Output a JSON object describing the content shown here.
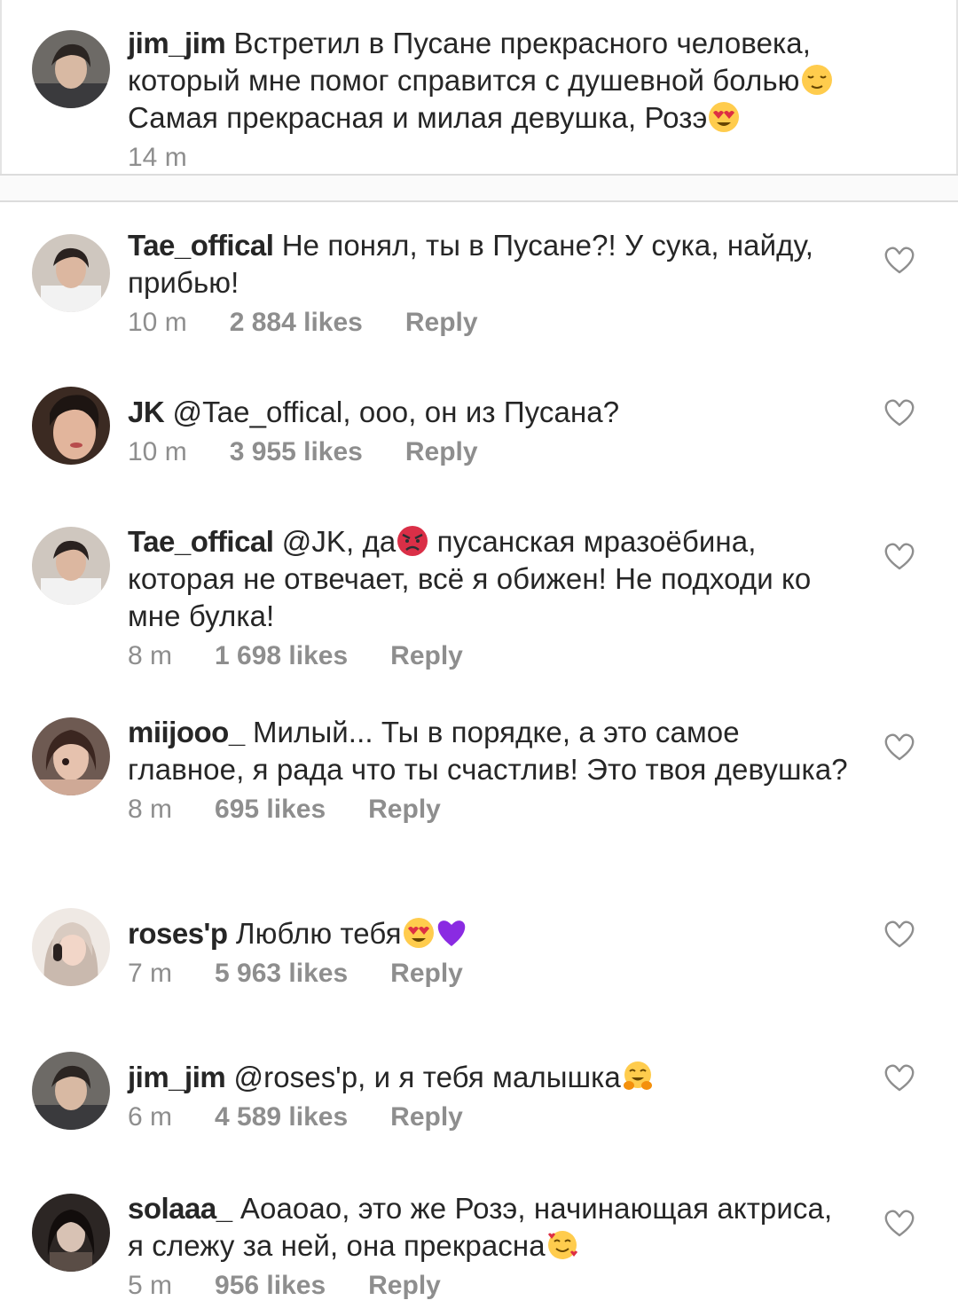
{
  "caption": {
    "username": "jim_jim",
    "text": "Встретил в Пусане прекрасного человека, который мне помог справится с душевной болью",
    "text_after_emoji": "Самая прекрасная и милая девушка, Розэ",
    "time": "14 m",
    "emoji_1": "relieved-face",
    "emoji_2": "heart-eyes-face"
  },
  "comments": [
    {
      "username": "Tae_offical",
      "text": "Не понял, ты в Пусане?! У сука, найду, прибью!",
      "time": "10 m",
      "likes": "2 884 likes",
      "reply": "Reply"
    },
    {
      "username": "JK",
      "text": "@Tae_offical, ооо, он из Пусана?",
      "time": "10 m",
      "likes": "3 955 likes",
      "reply": "Reply"
    },
    {
      "username": "Tae_offical",
      "text_before": "@JK, да",
      "emoji": "angry-face",
      "text_after": " пусанская мразоёбина, которая не отвечает, всё я обижен! Не подходи ко мне булка!",
      "time": "8 m",
      "likes": "1 698 likes",
      "reply": "Reply"
    },
    {
      "username": "miijooo_",
      "text": "Милый... Ты в порядке, а это самое главное, я рада что ты счастлив! Это твоя девушка?",
      "time": "8 m",
      "likes": "695 likes",
      "reply": "Reply"
    },
    {
      "username": "roses'p",
      "text": "Люблю тебя",
      "emoji_1": "heart-eyes-face",
      "emoji_2": "purple-heart",
      "time": "7 m",
      "likes": "5 963 likes",
      "reply": "Reply"
    },
    {
      "username": "jim_jim",
      "text": "@roses'p, и я тебя малышка",
      "emoji": "hugging-face",
      "time": "6 m",
      "likes": "4 589 likes",
      "reply": "Reply"
    },
    {
      "username": "solaaa_",
      "text": "Аоаоао, это же Розэ, начинающая актриса, я слежу за ней, она прекрасна",
      "emoji": "smiling-face-with-hearts",
      "time": "5 m",
      "likes": "956 likes",
      "reply": "Reply"
    }
  ],
  "icons": {
    "like": "heart-outline-icon"
  },
  "colors": {
    "text": "#262626",
    "meta": "#8e8e8e",
    "divider": "#dcdcdc",
    "heart_stroke": "#8e8e8e"
  }
}
